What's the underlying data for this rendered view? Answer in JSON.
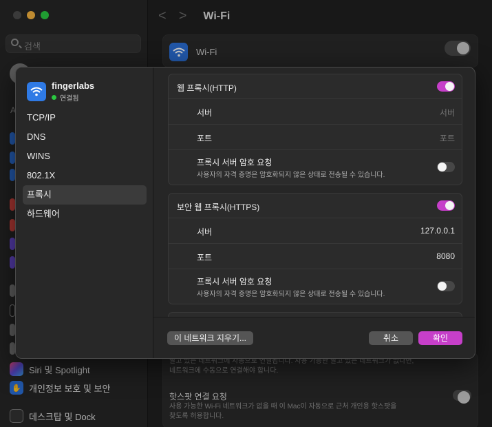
{
  "background": {
    "search_placeholder": "검색",
    "section_letter": "A",
    "title": "Wi-Fi",
    "nav_back": "<",
    "nav_forward": ">",
    "wifi_label": "Wi-Fi",
    "sidebar_items": [
      {
        "label": "Siri 및 Spotlight",
        "icon": "siri-icon",
        "color": "#5b4bd6"
      },
      {
        "label": "개인정보 보호 및 보안",
        "icon": "hand-icon",
        "color": "#2b6fd6"
      },
      {
        "label": "데스크탑 및 Dock",
        "icon": "dock-icon",
        "color": "#333333"
      }
    ],
    "obscured_text_1": "알고 있는 네트워크에 자동으로 연결됩니다. 사용 가능한 알고 있는 네트워크가 없다면,",
    "obscured_text_2": "네트워크에 수동으로 연결해야 합니다.",
    "hotspot_title": "핫스팟 연결 요청",
    "hotspot_desc_1": "사용 가능한 Wi-Fi 네트워크가 없을 때 이 Mac이 자동으로 근처 개인용 핫스팟을",
    "hotspot_desc_2": "찾도록 허용합니다."
  },
  "sheet": {
    "network": {
      "name": "fingerlabs",
      "status": "연결됨",
      "icon": "wifi-icon"
    },
    "sidebar": [
      {
        "label": "TCP/IP",
        "active": false
      },
      {
        "label": "DNS",
        "active": false
      },
      {
        "label": "WINS",
        "active": false
      },
      {
        "label": "802.1X",
        "active": false
      },
      {
        "label": "프록시",
        "active": true
      },
      {
        "label": "하드웨어",
        "active": false
      }
    ],
    "http_proxy": {
      "title": "웹 프록시(HTTP)",
      "enabled": true,
      "server_label": "서버",
      "server_placeholder": "서버",
      "port_label": "포트",
      "port_placeholder": "포트",
      "auth_label": "프록시 서버 암호 요청",
      "auth_desc": "사용자의 자격 증명은 암호화되지 않은 상태로 전송될 수 있습니다.",
      "auth_enabled": false
    },
    "https_proxy": {
      "title": "보안 웹 프록시(HTTPS)",
      "enabled": true,
      "server_label": "서버",
      "server_value": "127.0.0.1",
      "port_label": "포트",
      "port_value": "8080",
      "auth_label": "프록시 서버 암호 요청",
      "auth_desc": "사용자의 자격 증명은 암호화되지 않은 상태로 전송될 수 있습니다.",
      "auth_enabled": false
    },
    "footer": {
      "clear_label": "이 네트워크 지우기...",
      "cancel_label": "취소",
      "ok_label": "확인"
    }
  },
  "colors": {
    "accent": "#c63fc9",
    "wifi_blue": "#2f7ae5",
    "connected_green": "#2ac840"
  }
}
